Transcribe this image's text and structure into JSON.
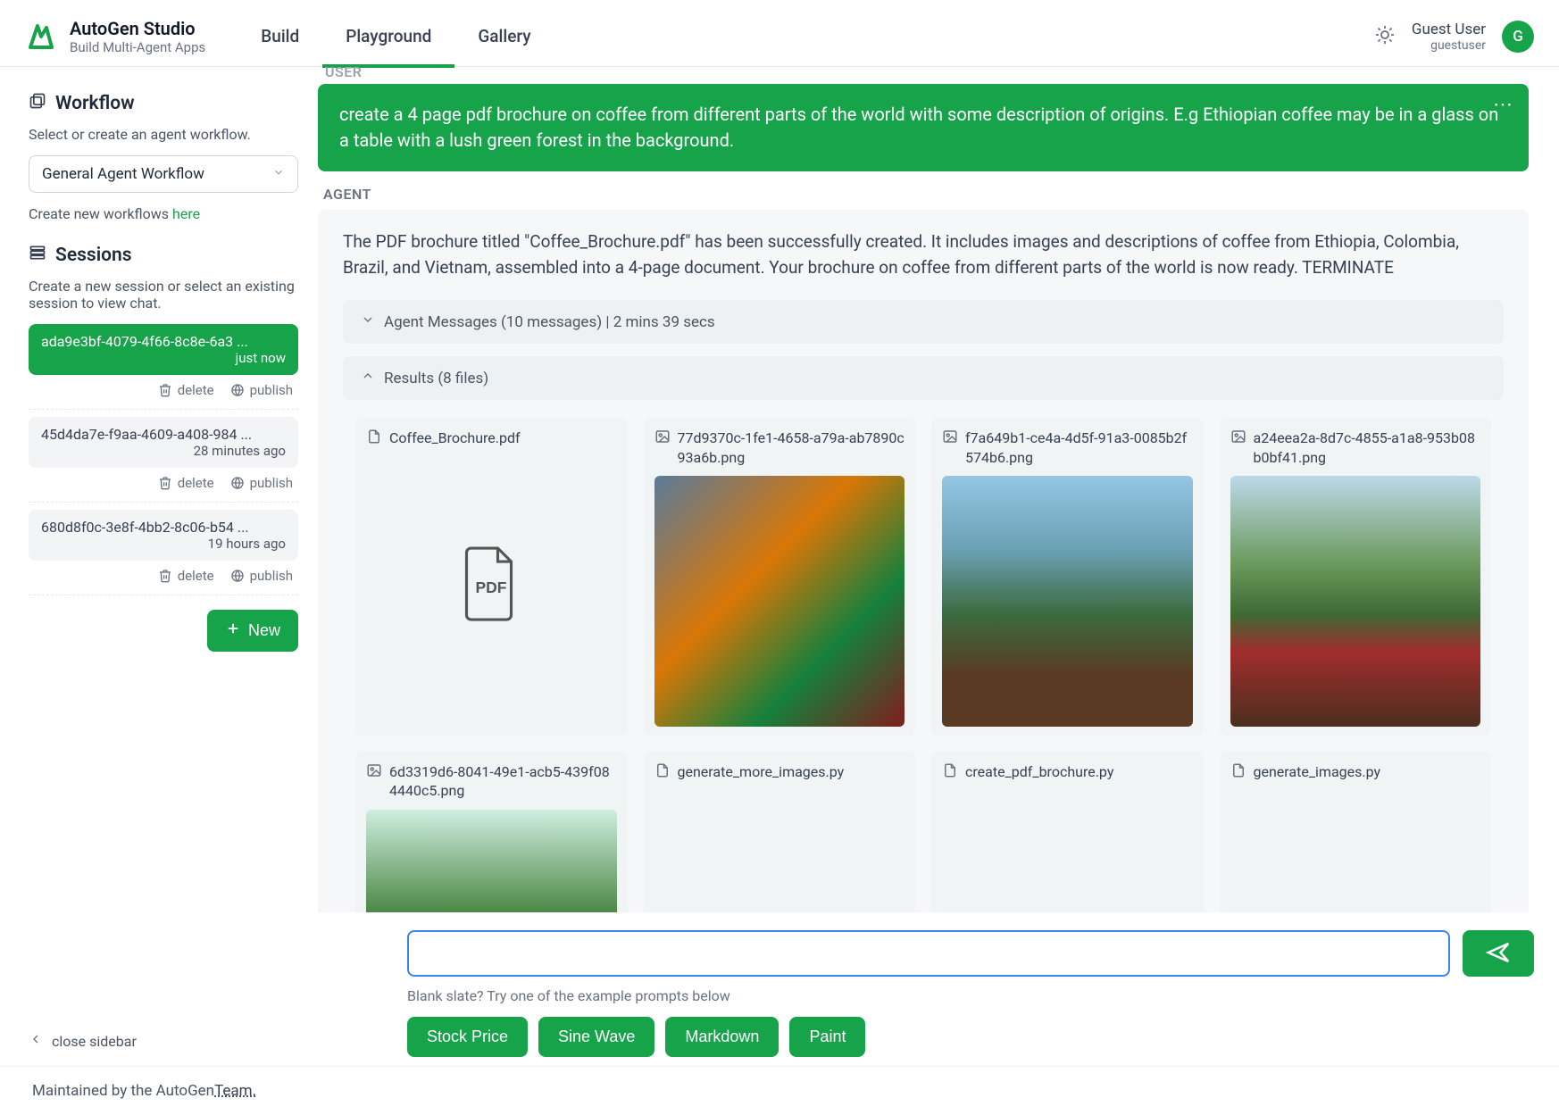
{
  "brand": {
    "title": "AutoGen Studio",
    "subtitle": "Build Multi-Agent Apps"
  },
  "tabs": {
    "build": "Build",
    "playground": "Playground",
    "gallery": "Gallery"
  },
  "user": {
    "name": "Guest User",
    "sub": "guestuser",
    "initial": "G"
  },
  "sidebar": {
    "workflow_h": "Workflow",
    "workflow_sub": "Select or create an agent workflow.",
    "workflow_selected": "General Agent Workflow",
    "create_new_prefix": "Create new workflows ",
    "create_new_link": "here",
    "sessions_h": "Sessions",
    "sessions_sub": "Create a new session or select an existing session to view chat.",
    "delete": "delete",
    "publish": "publish",
    "new_btn": "New",
    "close": "close sidebar",
    "sessions": [
      {
        "id": "ada9e3bf-4079-4f66-8c8e-6a3 ...",
        "time": "just now"
      },
      {
        "id": "45d4da7e-f9aa-4609-a408-984 ...",
        "time": "28 minutes ago"
      },
      {
        "id": "680d8f0c-3e8f-4bb2-8c06-b54 ...",
        "time": "19 hours ago"
      }
    ]
  },
  "chat": {
    "user_label": "USER",
    "agent_label": "AGENT",
    "user_msg": "create a 4 page pdf brochure on coffee from different parts of the world with some description of origins. E.g Ethiopian coffee may be in a glass on a table with a lush green forest in the background.",
    "agent_msg": "The PDF brochure titled \"Coffee_Brochure.pdf\" has been successfully created. It includes images and descriptions of coffee from Ethiopia, Colombia, Brazil, and Vietnam, assembled into a 4-page document. Your brochure on coffee from different parts of the world is now ready. TERMINATE",
    "agent_messages_acc": "Agent Messages (10 messages) | 2 mins 39 secs",
    "results_acc": "Results (8 files)",
    "files": [
      {
        "name": "Coffee_Brochure.pdf",
        "kind": "pdf"
      },
      {
        "name": "77d9370c-1fe1-4658-a79a-ab7890c93a6b.png",
        "kind": "image",
        "thumb": "market"
      },
      {
        "name": "f7a649b1-ce4a-4d5f-91a3-0085b2f574b6.png",
        "kind": "image",
        "thumb": "mountain"
      },
      {
        "name": "a24eea2a-8d7c-4855-a1a8-953b08b0bf41.png",
        "kind": "image",
        "thumb": "plantation"
      },
      {
        "name": "6d3319d6-8041-49e1-acb5-439f084440c5.png",
        "kind": "image",
        "thumb": "forest"
      },
      {
        "name": "generate_more_images.py",
        "kind": "py"
      },
      {
        "name": "create_pdf_brochure.py",
        "kind": "py"
      },
      {
        "name": "generate_images.py",
        "kind": "py"
      }
    ]
  },
  "input": {
    "blank": "Blank slate? Try one of the example prompts below",
    "suggestions": [
      "Stock Price",
      "Sine Wave",
      "Markdown",
      "Paint"
    ]
  },
  "footer": {
    "prefix": "Maintained by the AutoGen ",
    "link": "Team."
  }
}
